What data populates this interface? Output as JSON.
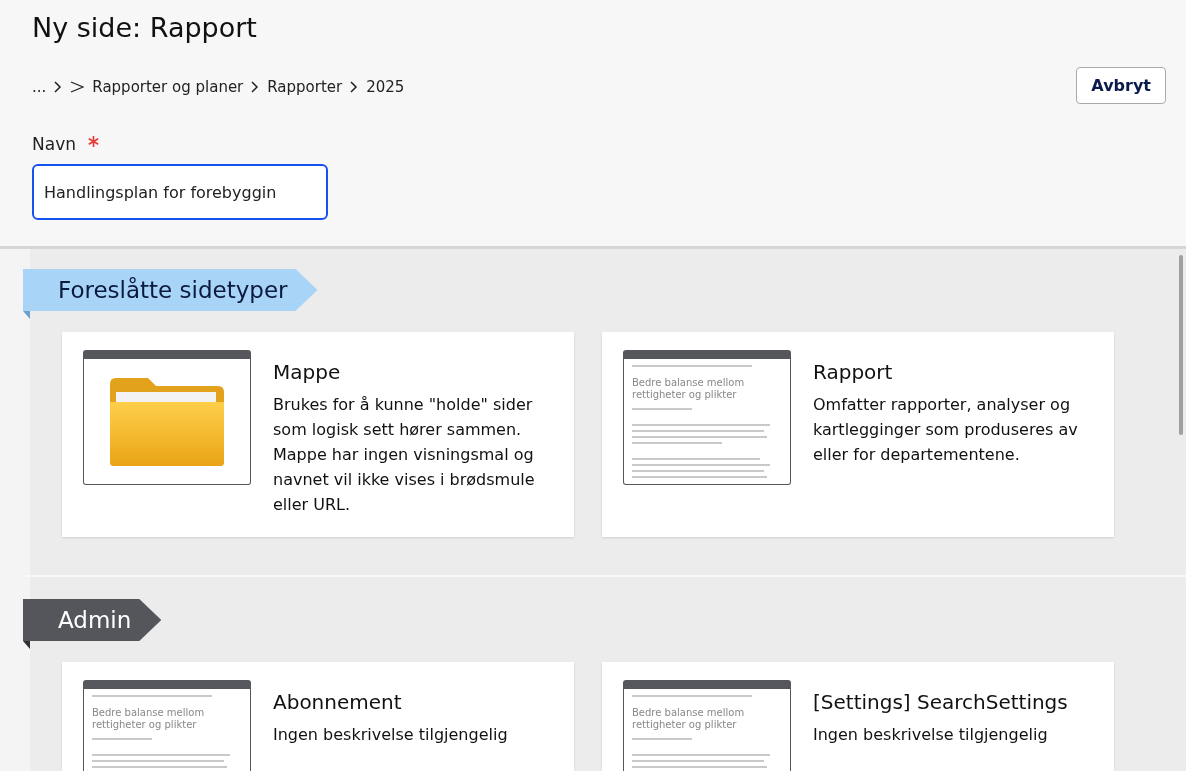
{
  "header": {
    "title": "Ny side: Rapport",
    "breadcrumb": [
      "...",
      "Rapporter og planer",
      "Rapporter",
      "2025"
    ],
    "cancel_button": "Avbryt"
  },
  "name_field": {
    "label": "Navn",
    "required": true,
    "value": "Handlingsplan for forebyggin"
  },
  "sections": [
    {
      "title": "Foreslåtte sidetyper",
      "kind": "suggested",
      "cards": [
        {
          "kind": "folder",
          "title": "Mappe",
          "description": "Brukes for å kunne \"holde\" sider som logisk sett hører sammen. Mappe har ingen visningsmal og navnet vil ikke vises i brødsmule eller URL."
        },
        {
          "kind": "page",
          "preview_title": "Bedre balanse mellom rettigheter og plikter",
          "title": "Rapport",
          "description": "Omfatter rapporter, analyser og kartlegginger som produseres av eller for departementene."
        }
      ]
    },
    {
      "title": "Admin",
      "kind": "group",
      "cards": [
        {
          "kind": "page",
          "preview_title": "Bedre balanse mellom rettigheter og plikter",
          "title": "Abonnement",
          "description": "Ingen beskrivelse tilgjengelig"
        },
        {
          "kind": "page",
          "preview_title": "Bedre balanse mellom rettigheter og plikter",
          "title": "[Settings] SearchSettings",
          "description": "Ingen beskrivelse tilgjengelig"
        }
      ]
    }
  ]
}
